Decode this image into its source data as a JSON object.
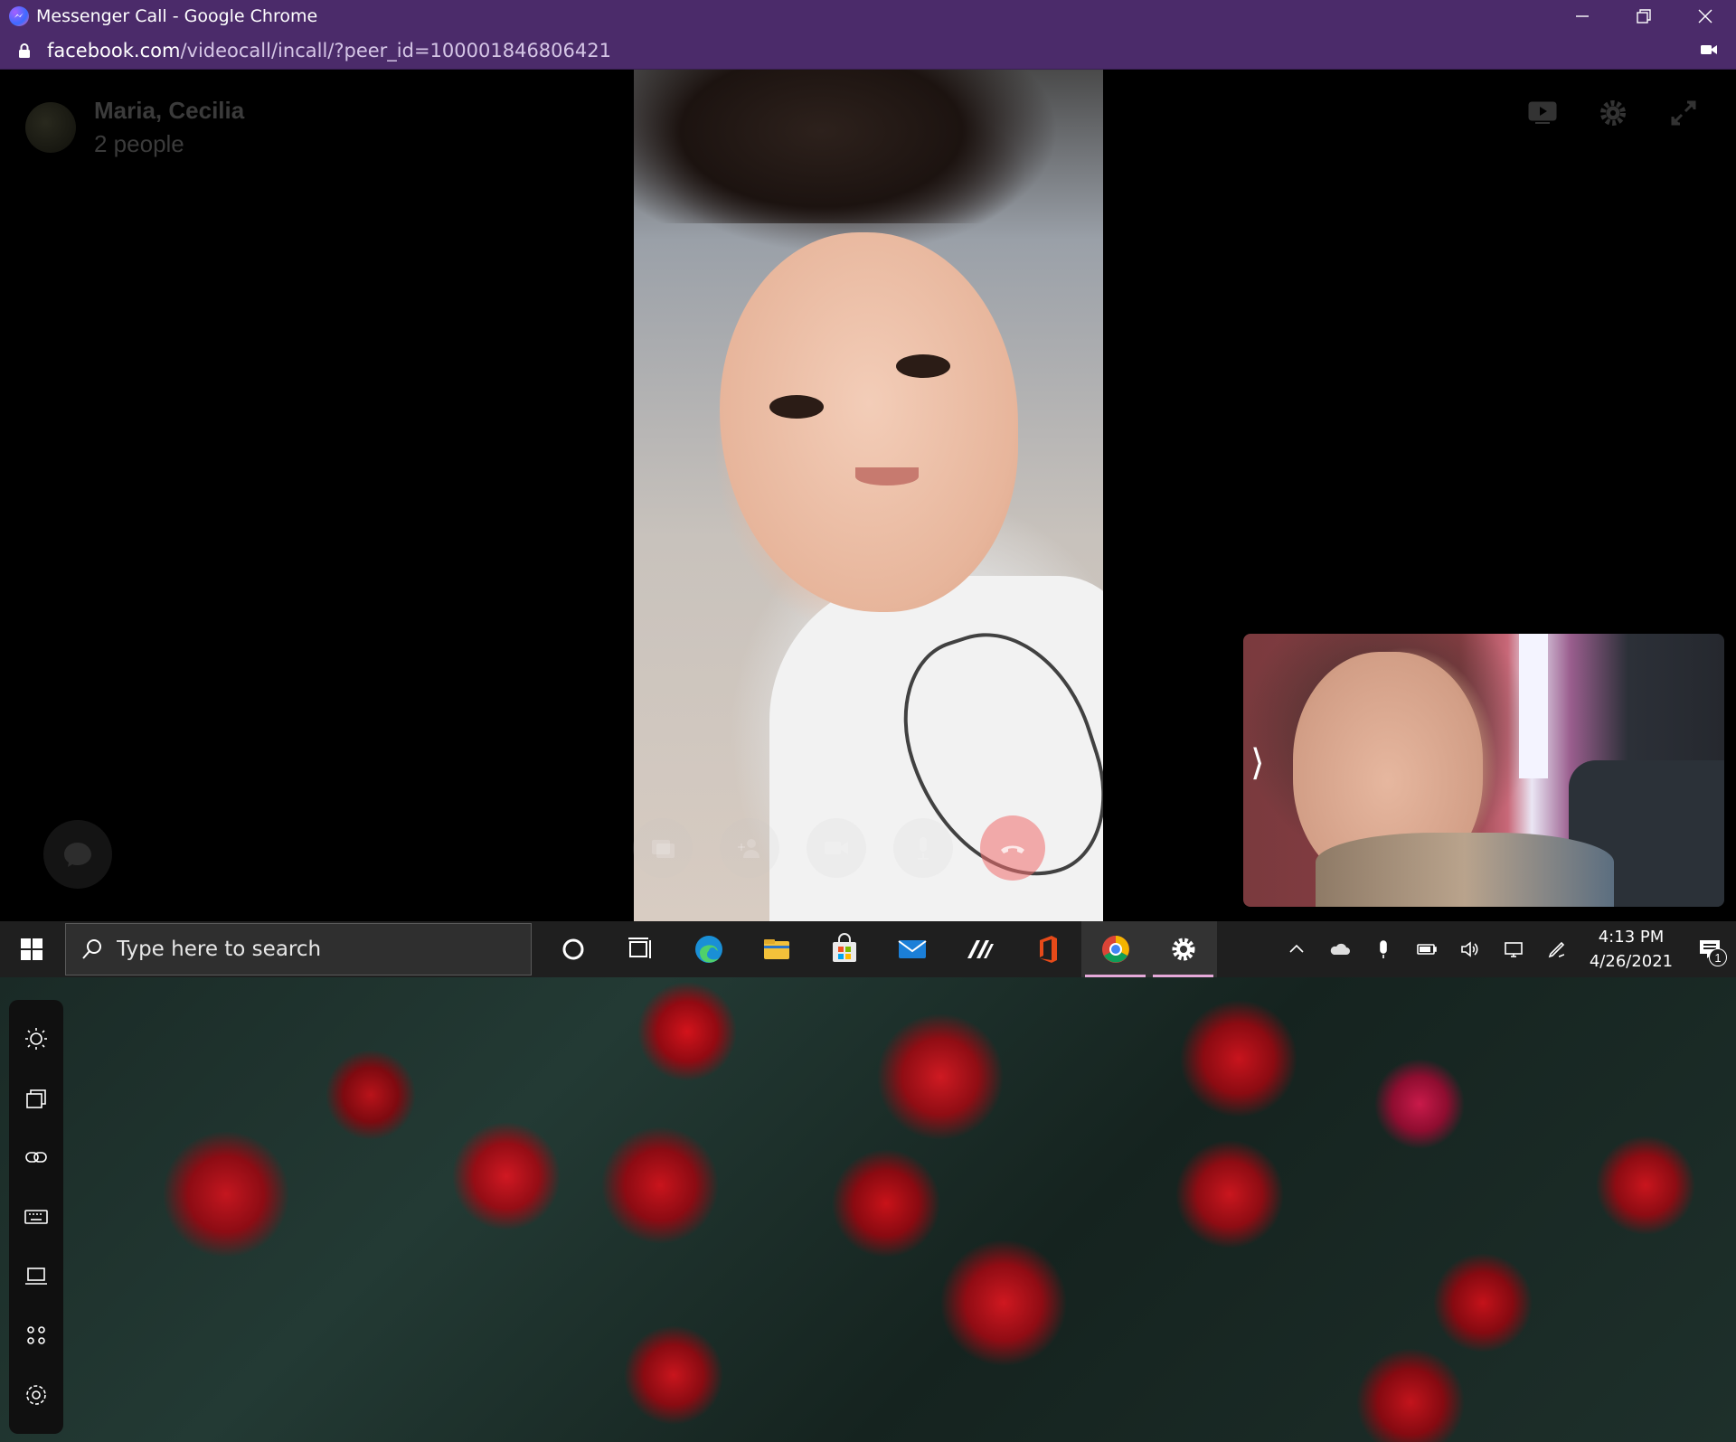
{
  "window": {
    "title": "Messenger Call - Google Chrome",
    "url_domain": "facebook.com",
    "url_path": "/videocall/incall/?peer_id=100001846806421"
  },
  "call": {
    "group_name": "Maria, Cecilia",
    "participants": "2 people",
    "top_icons": [
      "screen-share-icon",
      "settings-gear-icon",
      "fullscreen-icon"
    ],
    "controls": [
      "share-screen-button",
      "add-person-button",
      "video-toggle-button",
      "mute-button",
      "end-call-button"
    ],
    "expand_glyph": "⟩"
  },
  "taskbar": {
    "search_placeholder": "Type here to search",
    "pinned": [
      "cortana-icon",
      "task-view-icon",
      "edge-icon",
      "file-explorer-icon",
      "microsoft-store-icon",
      "mail-icon",
      "app-icon",
      "office-icon",
      "chrome-icon",
      "settings-icon"
    ],
    "active_apps": [
      "chrome-icon",
      "settings-icon"
    ],
    "time": "4:13 PM",
    "date": "4/26/2021",
    "notification_count": "1"
  },
  "side_dock": {
    "items": [
      "brightness-icon",
      "windows-icon",
      "link-icon",
      "keyboard-icon",
      "laptop-icon",
      "apps-icon",
      "settings-gear-icon"
    ]
  },
  "colors": {
    "chrome_frame": "#4b2b6a",
    "taskbar": "#1f1f1f",
    "active_indicator": "#e5a9d9"
  }
}
